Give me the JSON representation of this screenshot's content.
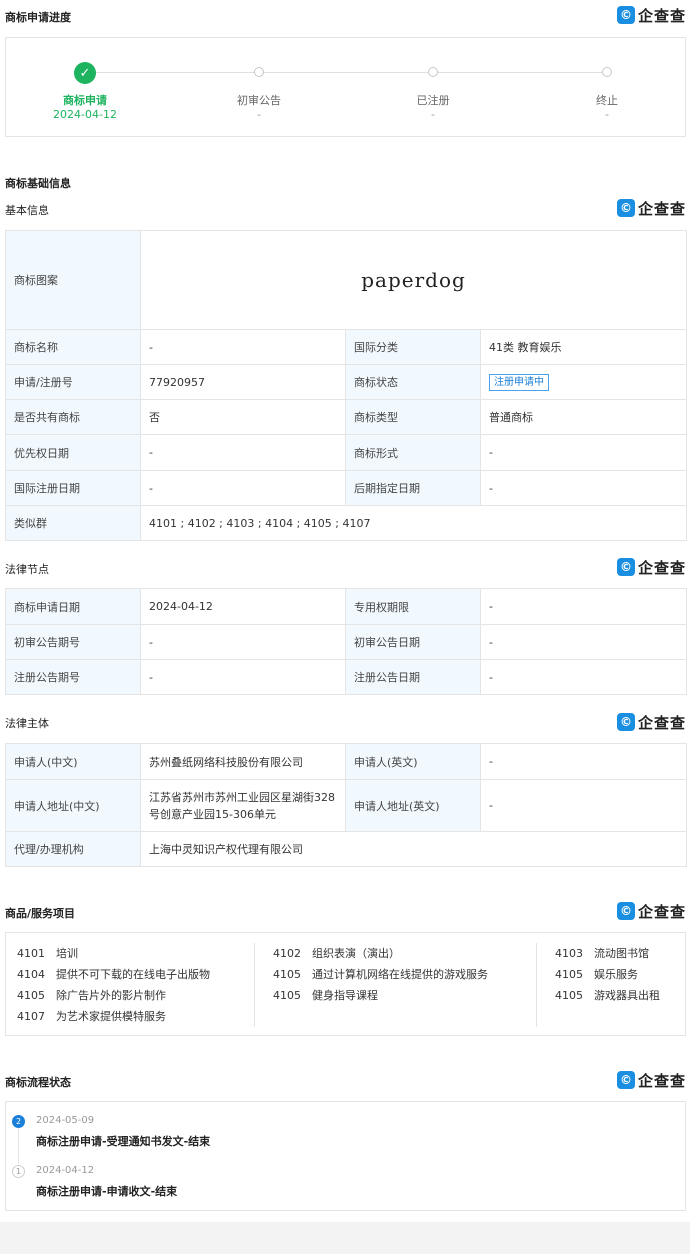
{
  "progress": {
    "title": "商标申请进度",
    "steps": [
      {
        "name": "商标申请",
        "date": "2024-04-12",
        "active": true
      },
      {
        "name": "初审公告",
        "date": "-",
        "active": false
      },
      {
        "name": "已注册",
        "date": "-",
        "active": false
      },
      {
        "name": "终止",
        "date": "-",
        "active": false
      }
    ]
  },
  "brand": {
    "word": "企查查",
    "mark": "Q"
  },
  "basic": {
    "section_title": "商标基础信息",
    "sub_title": "基本信息",
    "image_label": "商标图案",
    "image_text": "paperdog",
    "rows": [
      {
        "k1": "商标名称",
        "v1": "-",
        "k2": "国际分类",
        "v2": "41类 教育娱乐"
      },
      {
        "k1": "申请/注册号",
        "v1": "77920957",
        "k2": "商标状态",
        "v2": "注册申请中"
      },
      {
        "k1": "是否共有商标",
        "v1": "否",
        "k2": "商标类型",
        "v2": "普通商标"
      },
      {
        "k1": "优先权日期",
        "v1": "-",
        "k2": "商标形式",
        "v2": "-"
      },
      {
        "k1": "国际注册日期",
        "v1": "-",
        "k2": "后期指定日期",
        "v2": "-"
      }
    ],
    "similar_label": "类似群",
    "similar_value": "4101 ; 4102 ; 4103 ; 4104 ; 4105 ; 4107"
  },
  "legal_nodes": {
    "title": "法律节点",
    "rows": [
      {
        "k1": "商标申请日期",
        "v1": "2024-04-12",
        "k2": "专用权期限",
        "v2": "-"
      },
      {
        "k1": "初审公告期号",
        "v1": "-",
        "k2": "初审公告日期",
        "v2": "-"
      },
      {
        "k1": "注册公告期号",
        "v1": "-",
        "k2": "注册公告日期",
        "v2": "-"
      }
    ]
  },
  "legal_subject": {
    "title": "法律主体",
    "applicant_cn_label": "申请人(中文)",
    "applicant_cn": "苏州叠纸网络科技股份有限公司",
    "applicant_en_label": "申请人(英文)",
    "applicant_en": "-",
    "addr_cn_label": "申请人地址(中文)",
    "addr_cn": "江苏省苏州市苏州工业园区星湖街328号创意产业园15-306单元",
    "addr_en_label": "申请人地址(英文)",
    "addr_en": "-",
    "agent_label": "代理/办理机构",
    "agent": "上海中灵知识产权代理有限公司"
  },
  "goods": {
    "title": "商品/服务项目",
    "col1": [
      {
        "code": "4101",
        "name": "培训"
      },
      {
        "code": "4104",
        "name": "提供不可下载的在线电子出版物"
      },
      {
        "code": "4105",
        "name": "除广告片外的影片制作"
      },
      {
        "code": "4107",
        "name": "为艺术家提供模特服务"
      }
    ],
    "col2": [
      {
        "code": "4102",
        "name": "组织表演（演出）"
      },
      {
        "code": "4105",
        "name": "通过计算机网络在线提供的游戏服务"
      },
      {
        "code": "4105",
        "name": "健身指导课程"
      }
    ],
    "col3": [
      {
        "code": "4103",
        "name": "流动图书馆"
      },
      {
        "code": "4105",
        "name": "娱乐服务"
      },
      {
        "code": "4105",
        "name": "游戏器具出租"
      }
    ]
  },
  "flow": {
    "title": "商标流程状态",
    "items": [
      {
        "num": "2",
        "date": "2024-05-09",
        "text": "商标注册申请-受理通知书发文-结束"
      },
      {
        "num": "1",
        "date": "2024-04-12",
        "text": "商标注册申请-申请收文-结束"
      }
    ]
  }
}
